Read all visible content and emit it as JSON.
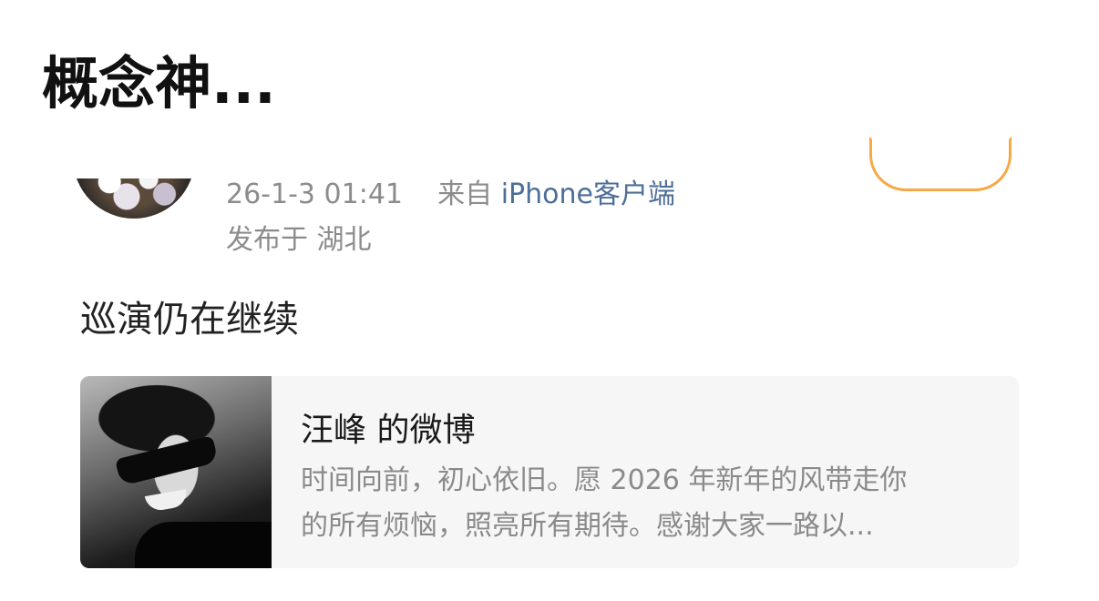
{
  "headline": "概念神...",
  "post": {
    "timestamp": "26-1-3 01:41",
    "source_prefix": "来自",
    "source": "iPhone客户端",
    "location": "发布于 湖北",
    "text": "巡演仍在继续"
  },
  "card": {
    "title": "汪峰 的微博",
    "desc_line1": "时间向前，初心依旧。愿 2026 年新年的风带走你",
    "desc_line2": "的所有烦恼，照亮所有期待。感谢大家一路以..."
  },
  "colors": {
    "source_link": "#4e6e9a",
    "follow_outline": "#f5a947",
    "meta_gray": "#8c8c8c"
  }
}
